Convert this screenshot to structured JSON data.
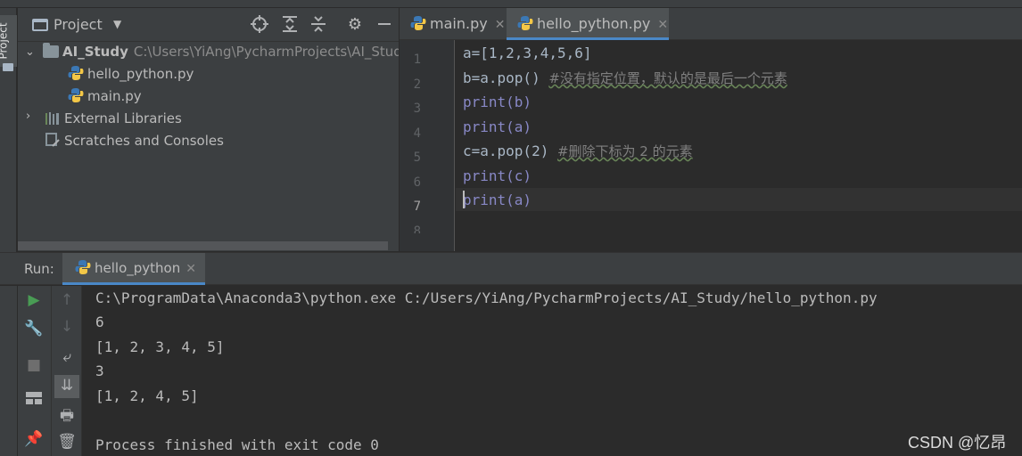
{
  "sidebar": {
    "tab_label": "Project"
  },
  "project": {
    "header_title": "Project",
    "tree": {
      "root_name": "AI_Study",
      "root_path": "C:\\Users\\YiAng\\PycharmProjects\\AI_Study",
      "files": [
        "hello_python.py",
        "main.py"
      ],
      "external": "External Libraries",
      "scratches": "Scratches and Consoles"
    }
  },
  "editor": {
    "tabs": [
      {
        "label": "main.py",
        "active": false
      },
      {
        "label": "hello_python.py",
        "active": true
      }
    ],
    "line_numbers": [
      "1",
      "2",
      "3",
      "4",
      "5",
      "6",
      "7",
      "8"
    ],
    "code": {
      "l1": "a=[1,2,3,4,5,6]",
      "l2_code": "b=a.pop() ",
      "l2_comment": "#没有指定位置，默认的是最后一个元素",
      "l3": "print(b)",
      "l4": "print(a)",
      "l5_code": "c=a.pop(2) ",
      "l5_comment": "#删除下标为 2 的元素",
      "l6": "print(c)",
      "l7": "print(a)"
    }
  },
  "run": {
    "label": "Run:",
    "tab_label": "hello_python",
    "console_lines": [
      "C:\\ProgramData\\Anaconda3\\python.exe C:/Users/YiAng/PycharmProjects/AI_Study/hello_python.py",
      "6",
      "[1, 2, 3, 4, 5]",
      "3",
      "[1, 2, 4, 5]",
      "",
      "Process finished with exit code 0"
    ]
  },
  "watermark": "CSDN @忆昂",
  "colors": {
    "accent": "#4a88c7",
    "keyword": "#8888c6",
    "number": "#6897bb",
    "comment": "#808080"
  }
}
